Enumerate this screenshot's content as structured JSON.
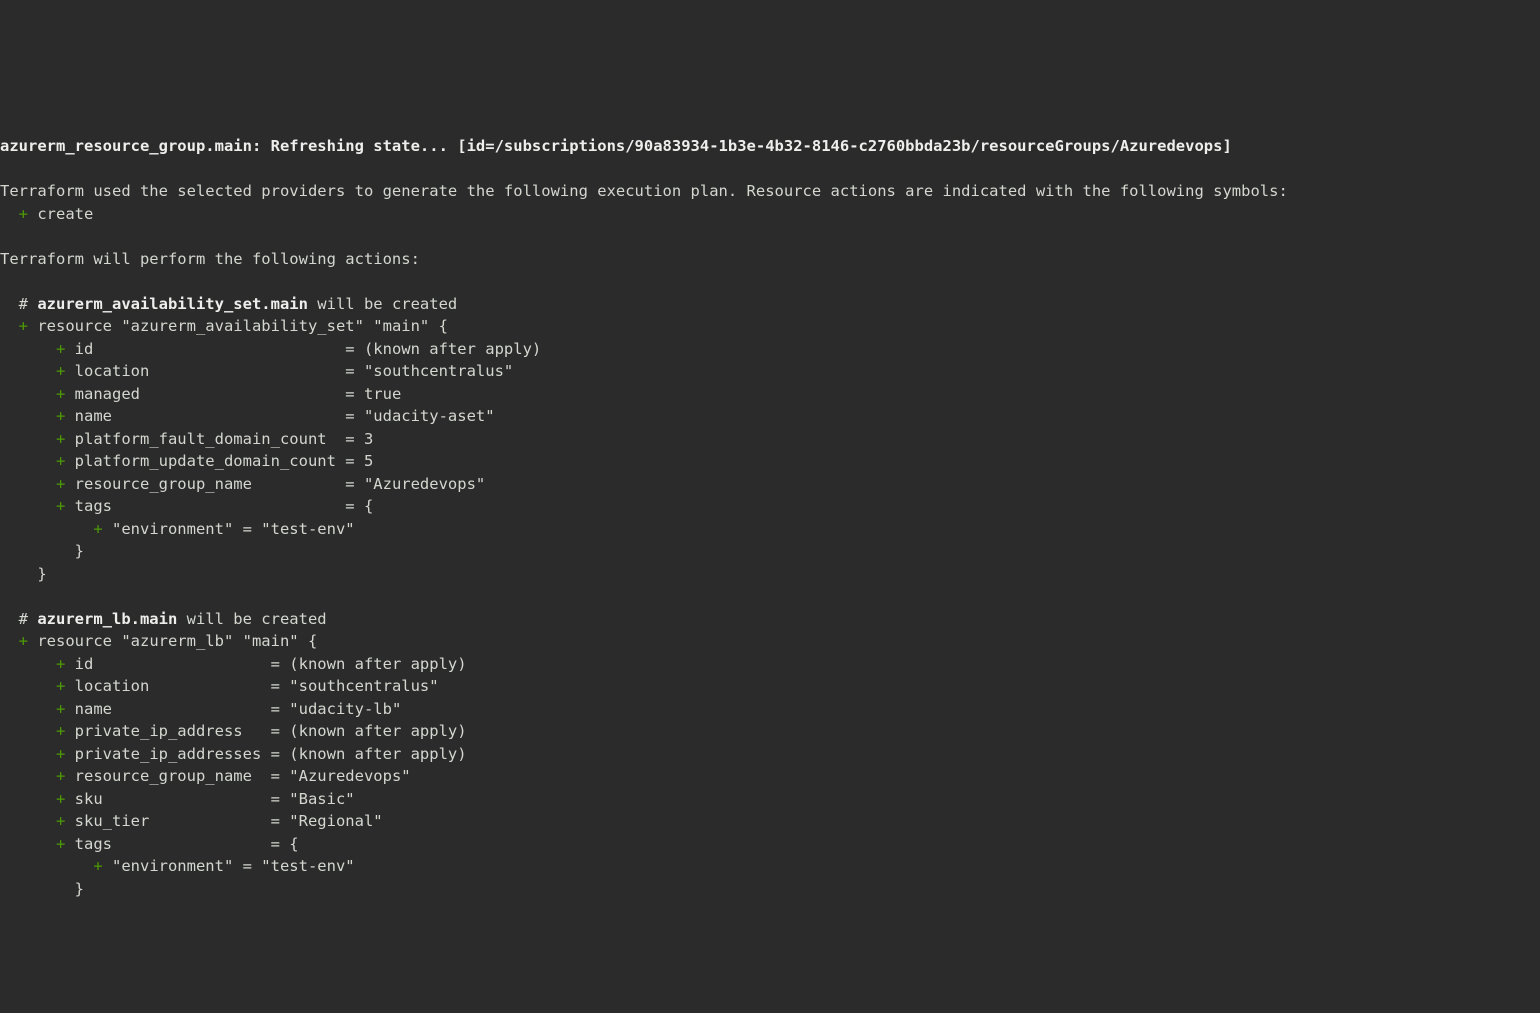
{
  "refresh_line_prefix": "azurerm_resource_group.main: Refreshing state... [id=/subscriptions/90a83934-1b3e-4b32-8146-c2760bbda23b/resourceGroups/Azuredevops]",
  "blank": "",
  "plan_intro": "Terraform used the selected providers to generate the following execution plan. Resource actions are indicated with the following symbols:",
  "create_marker": "  +",
  "create_label": " create",
  "actions_header": "Terraform will perform the following actions:",
  "res1": {
    "hash_prefix": "  # ",
    "addr": "azurerm_availability_set.main",
    "suffix": " will be created",
    "open_plus": "  +",
    "open_rest": " resource \"azurerm_availability_set\" \"main\" {",
    "attrs": [
      {
        "plus": "      +",
        "line": " id                           = (known after apply)"
      },
      {
        "plus": "      +",
        "line": " location                     = \"southcentralus\""
      },
      {
        "plus": "      +",
        "line": " managed                      = true"
      },
      {
        "plus": "      +",
        "line": " name                         = \"udacity-aset\""
      },
      {
        "plus": "      +",
        "line": " platform_fault_domain_count  = 3"
      },
      {
        "plus": "      +",
        "line": " platform_update_domain_count = 5"
      },
      {
        "plus": "      +",
        "line": " resource_group_name          = \"Azuredevops\""
      },
      {
        "plus": "      +",
        "line": " tags                         = {"
      }
    ],
    "tag_plus": "          +",
    "tag_line": " \"environment\" = \"test-env\"",
    "tag_close": "        }",
    "close": "    }"
  },
  "res2": {
    "hash_prefix": "  # ",
    "addr": "azurerm_lb.main",
    "suffix": " will be created",
    "open_plus": "  +",
    "open_rest": " resource \"azurerm_lb\" \"main\" {",
    "attrs": [
      {
        "plus": "      +",
        "line": " id                   = (known after apply)"
      },
      {
        "plus": "      +",
        "line": " location             = \"southcentralus\""
      },
      {
        "plus": "      +",
        "line": " name                 = \"udacity-lb\""
      },
      {
        "plus": "      +",
        "line": " private_ip_address   = (known after apply)"
      },
      {
        "plus": "      +",
        "line": " private_ip_addresses = (known after apply)"
      },
      {
        "plus": "      +",
        "line": " resource_group_name  = \"Azuredevops\""
      },
      {
        "plus": "      +",
        "line": " sku                  = \"Basic\""
      },
      {
        "plus": "      +",
        "line": " sku_tier             = \"Regional\""
      },
      {
        "plus": "      +",
        "line": " tags                 = {"
      }
    ],
    "tag_plus": "          +",
    "tag_line": " \"environment\" = \"test-env\"",
    "tag_close": "        }"
  }
}
